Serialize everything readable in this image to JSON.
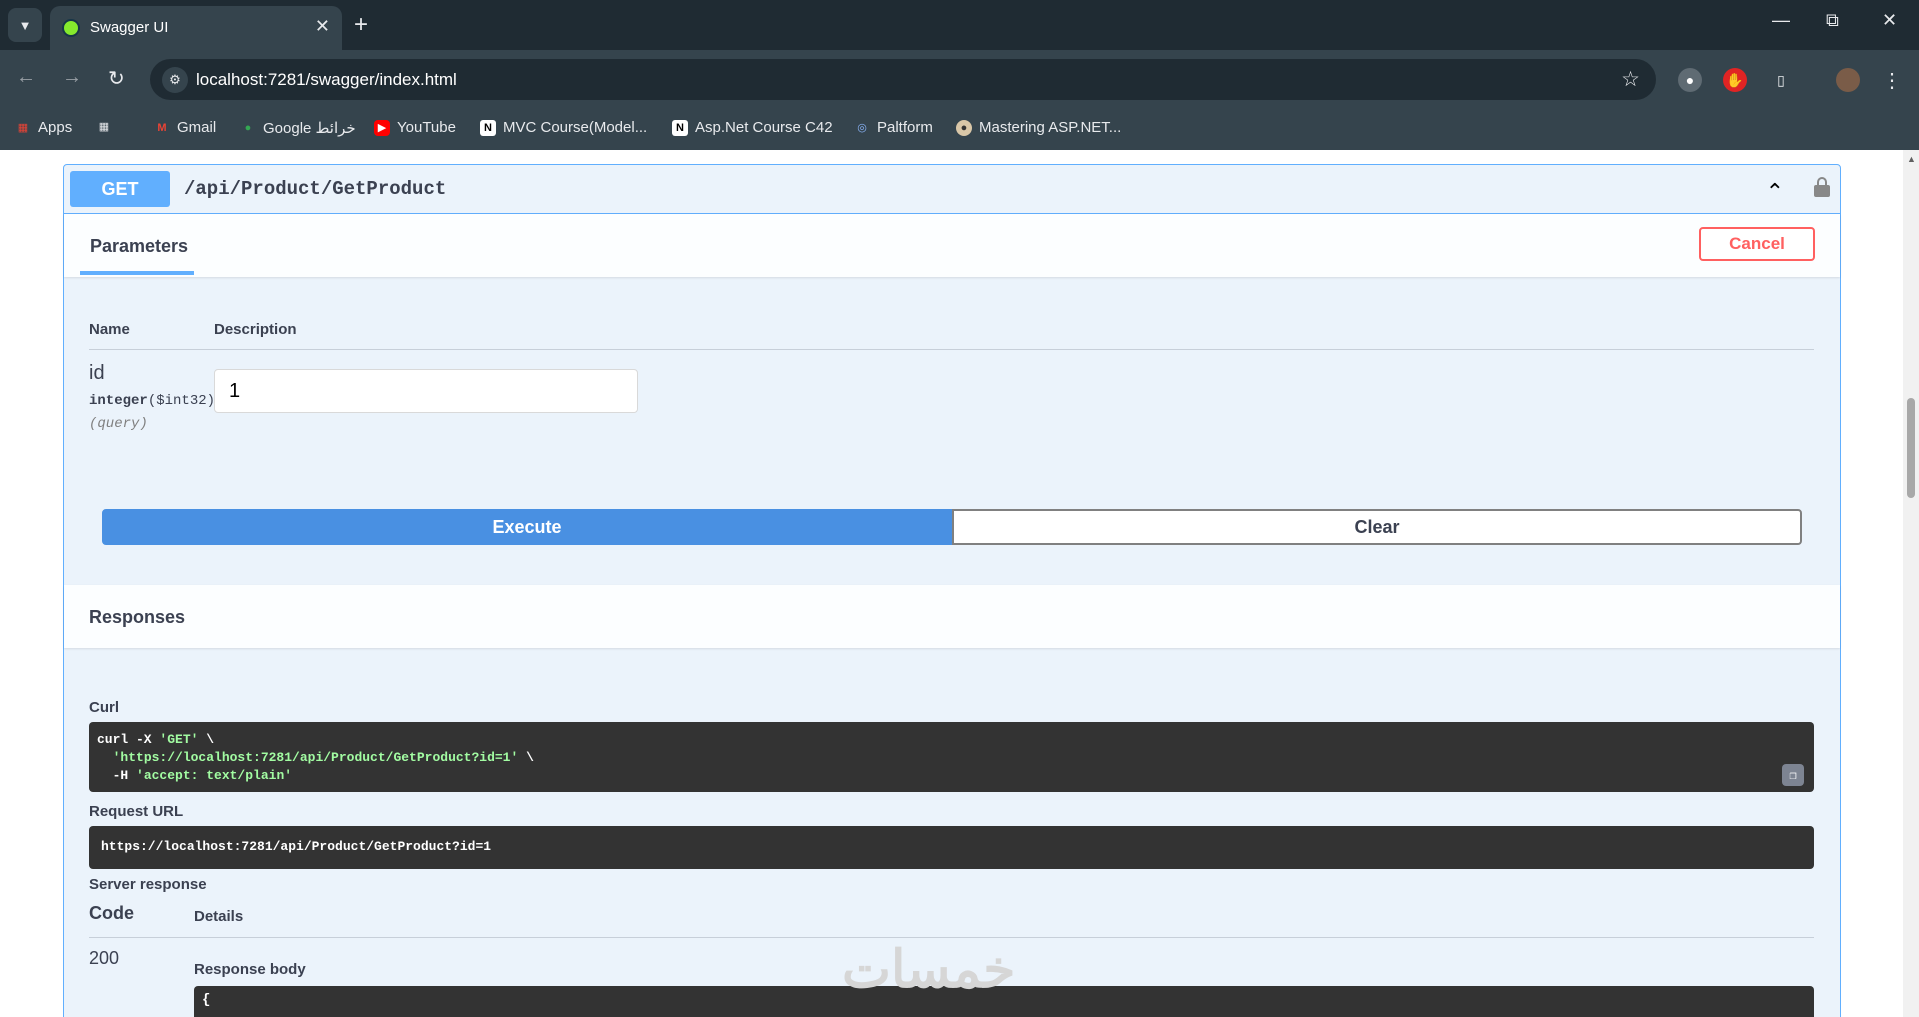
{
  "browser": {
    "tab_title": "Swagger UI",
    "url": "localhost:7281/swagger/index.html",
    "bookmarks": [
      {
        "label": "Apps",
        "icon": "apps-grid-icon"
      },
      {
        "label": "Gmail",
        "icon": "gmail-icon"
      },
      {
        "label": "Google خرائط",
        "icon": "google-maps-icon"
      },
      {
        "label": "YouTube",
        "icon": "youtube-icon"
      },
      {
        "label": "MVC Course(Model...",
        "icon": "notion-icon"
      },
      {
        "label": "Asp.Net Course C42",
        "icon": "notion-icon"
      },
      {
        "label": "Paltform",
        "icon": "platform-icon"
      },
      {
        "label": "Mastering ASP.NET...",
        "icon": "course-icon"
      }
    ]
  },
  "operation": {
    "method": "GET",
    "path": "/api/Product/GetProduct"
  },
  "parameters": {
    "tab_label": "Parameters",
    "cancel_label": "Cancel",
    "name_header": "Name",
    "description_header": "Description",
    "param_name": "id",
    "param_type": "integer",
    "param_format": "($int32)",
    "param_in": "(query)",
    "param_value": "1",
    "execute_label": "Execute",
    "clear_label": "Clear"
  },
  "responses": {
    "title": "Responses",
    "curl_label": "Curl",
    "curl_cmd1": "curl -X ",
    "curl_method": "'GET'",
    "curl_tail1": " \\",
    "curl_url": "'https://localhost:7281/api/Product/GetProduct?id=1'",
    "curl_tail2": " \\",
    "curl_h": "  -H ",
    "curl_header": "'accept: text/plain'",
    "request_url_label": "Request URL",
    "request_url": "https://localhost:7281/api/Product/GetProduct?id=1",
    "server_response_label": "Server response",
    "code_header": "Code",
    "details_header": "Details",
    "status_code": "200",
    "response_body_label": "Response body",
    "response_body_start": "{"
  },
  "watermark": "خمسات",
  "colors": {
    "get_blue": "#61affe",
    "execute_blue": "#4990e2",
    "cancel_red": "#ff6060",
    "code_bg": "#333333",
    "string_green": "#a2fca2"
  }
}
